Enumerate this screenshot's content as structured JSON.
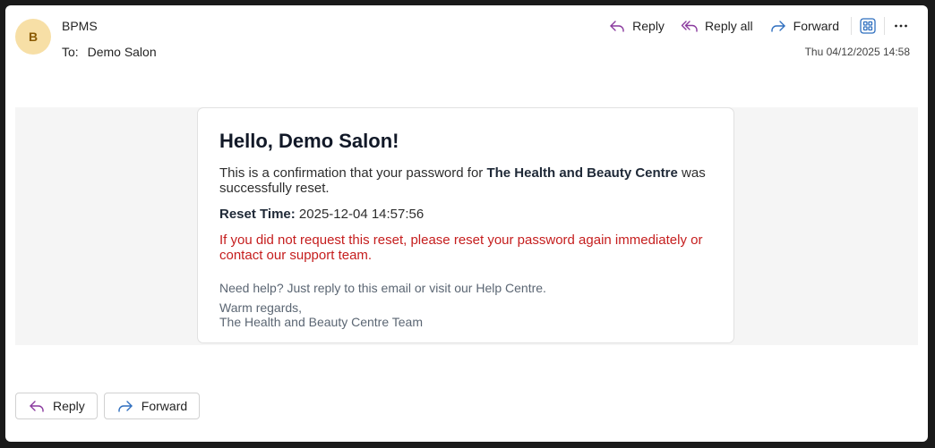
{
  "header": {
    "avatar_initial": "B",
    "sender": "BPMS",
    "to_label": "To:",
    "to_value": "Demo Salon",
    "date": "Thu 04/12/2025 14:58"
  },
  "toolbar": {
    "reply_label": "Reply",
    "reply_all_label": "Reply all",
    "forward_label": "Forward"
  },
  "email": {
    "greeting": "Hello, Demo Salon!",
    "intro_before": "This is a confirmation that your password for ",
    "intro_business": "The Health and Beauty Centre",
    "intro_after": " was successfully reset.",
    "reset_time_label": "Reset Time:",
    "reset_time_value": " 2025-12-04 14:57:56",
    "warning": "If you did not request this reset, please reset your password again immediately or contact our support team.",
    "help": "Need help? Just reply to this email or visit our Help Centre.",
    "regards": "Warm regards,",
    "signature": "The Health and Beauty Centre Team"
  },
  "footer": {
    "reply_label": "Reply",
    "forward_label": "Forward"
  },
  "colors": {
    "reply_icon": "#8a3a9e",
    "forward_icon": "#2f6fbf",
    "warning_text": "#c51d1d",
    "avatar_bg": "#f7dfa6"
  }
}
